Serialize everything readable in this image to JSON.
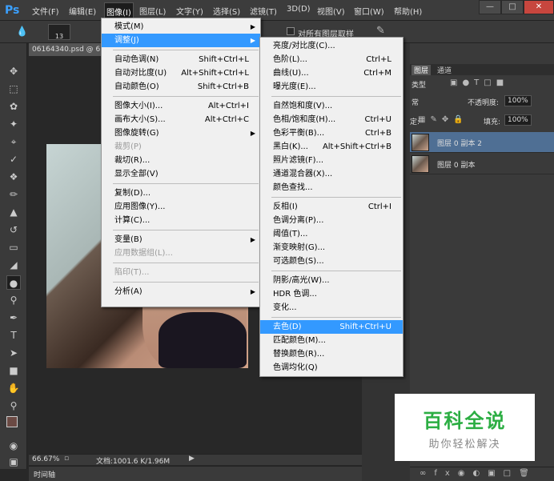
{
  "app": {
    "logo": "Ps",
    "menus": [
      "文件(F)",
      "编辑(E)",
      "图像(I)",
      "图层(L)",
      "文字(Y)",
      "选择(S)",
      "滤镜(T)",
      "3D(D)",
      "视图(V)",
      "窗口(W)",
      "帮助(H)"
    ],
    "active_menu": "图像(I)"
  },
  "options_bar": {
    "brush_size": "13",
    "sample_all_layers_label": "对所有图层取样"
  },
  "document": {
    "tab_title": "06164340.psd @ 6",
    "zoom": "66.67%",
    "doc_info": "文档:1001.6 K/1.96M",
    "timeline_label": "时间轴"
  },
  "image_menu": [
    {
      "label": "模式(M)",
      "sub": true
    },
    {
      "label": "调整(J)",
      "sub": true,
      "highlight": true
    },
    {
      "sep": true
    },
    {
      "label": "自动色调(N)",
      "shortcut": "Shift+Ctrl+L"
    },
    {
      "label": "自动对比度(U)",
      "shortcut": "Alt+Shift+Ctrl+L"
    },
    {
      "label": "自动颜色(O)",
      "shortcut": "Shift+Ctrl+B"
    },
    {
      "sep": true
    },
    {
      "label": "图像大小(I)...",
      "shortcut": "Alt+Ctrl+I"
    },
    {
      "label": "画布大小(S)...",
      "shortcut": "Alt+Ctrl+C"
    },
    {
      "label": "图像旋转(G)",
      "sub": true
    },
    {
      "label": "裁剪(P)",
      "disabled": true
    },
    {
      "label": "裁切(R)..."
    },
    {
      "label": "显示全部(V)"
    },
    {
      "sep": true
    },
    {
      "label": "复制(D)..."
    },
    {
      "label": "应用图像(Y)..."
    },
    {
      "label": "计算(C)..."
    },
    {
      "sep": true
    },
    {
      "label": "变量(B)",
      "sub": true
    },
    {
      "label": "应用数据组(L)...",
      "disabled": true
    },
    {
      "sep": true
    },
    {
      "label": "陷印(T)...",
      "disabled": true
    },
    {
      "sep": true
    },
    {
      "label": "分析(A)",
      "sub": true
    }
  ],
  "adjust_menu": [
    {
      "label": "亮度/对比度(C)..."
    },
    {
      "label": "色阶(L)...",
      "shortcut": "Ctrl+L"
    },
    {
      "label": "曲线(U)...",
      "shortcut": "Ctrl+M"
    },
    {
      "label": "曝光度(E)..."
    },
    {
      "sep": true
    },
    {
      "label": "自然饱和度(V)..."
    },
    {
      "label": "色相/饱和度(H)...",
      "shortcut": "Ctrl+U"
    },
    {
      "label": "色彩平衡(B)...",
      "shortcut": "Ctrl+B"
    },
    {
      "label": "黑白(K)...",
      "shortcut": "Alt+Shift+Ctrl+B"
    },
    {
      "label": "照片滤镜(F)..."
    },
    {
      "label": "通道混合器(X)..."
    },
    {
      "label": "颜色查找..."
    },
    {
      "sep": true
    },
    {
      "label": "反相(I)",
      "shortcut": "Ctrl+I"
    },
    {
      "label": "色调分离(P)..."
    },
    {
      "label": "阈值(T)..."
    },
    {
      "label": "渐变映射(G)..."
    },
    {
      "label": "可选颜色(S)..."
    },
    {
      "sep": true
    },
    {
      "label": "阴影/高光(W)..."
    },
    {
      "label": "HDR 色调..."
    },
    {
      "label": "变化..."
    },
    {
      "sep": true
    },
    {
      "label": "去色(D)",
      "shortcut": "Shift+Ctrl+U",
      "highlight": true
    },
    {
      "label": "匹配颜色(M)..."
    },
    {
      "label": "替换颜色(R)..."
    },
    {
      "label": "色调均化(Q)"
    }
  ],
  "layers_panel": {
    "tabs": [
      "图层",
      "通道"
    ],
    "filter_label": "类型",
    "blend_mode": "常",
    "opacity_label": "不透明度:",
    "opacity_value": "100%",
    "fill_label": "填充:",
    "fill_value": "100%",
    "lock_label": "定:",
    "layers": [
      {
        "name": "图层 0 副本 2",
        "selected": true
      },
      {
        "name": "图层 0 副本",
        "selected": false
      }
    ]
  },
  "watermark": {
    "title": "百科全说",
    "subtitle": "助你轻松解决"
  },
  "colors": {
    "menu_highlight": "#3399ff",
    "layer_selected": "#4f6f94",
    "ps_blue": "#3ba0ff",
    "watermark_green": "#2cae43"
  }
}
